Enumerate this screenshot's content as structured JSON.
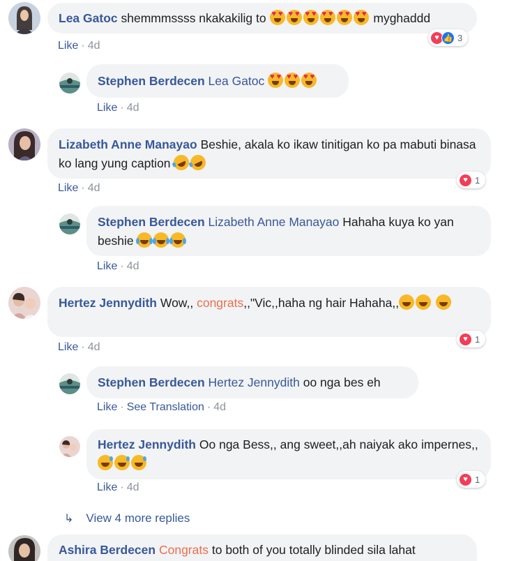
{
  "comments": [
    {
      "author": "Lea Gatoc",
      "text": "shemmmssss nkakakilig to",
      "text_after": "myghaddd",
      "emoji_count": 6,
      "like": "Like",
      "time": "4d",
      "reactions": {
        "count": "3",
        "icons": [
          "love-icon",
          "like-icon"
        ]
      }
    },
    {
      "author": "Stephen Berdecen",
      "mention": "Lea Gatoc",
      "like": "Like",
      "time": "4d"
    },
    {
      "author": "Lizabeth Anne Manayao",
      "text": "Beshie, akala ko ikaw tinitigan ko pa mabuti binasa ko lang yung caption",
      "like": "Like",
      "time": "4d",
      "reactions": {
        "count": "1",
        "icons": [
          "love-icon"
        ]
      }
    },
    {
      "author": "Stephen Berdecen",
      "mention": "Lizabeth Anne Manayao",
      "text": "Hahaha kuya ko yan beshie",
      "like": "Like",
      "time": "4d"
    },
    {
      "author": "Hertez Jennydith",
      "text_pre": "Wow,,",
      "highlight": "congrats",
      "text_post": ",,\"Vic,,haha ng hair Hahaha,,",
      "like": "Like",
      "time": "4d",
      "reactions": {
        "count": "1",
        "icons": [
          "love-icon"
        ]
      }
    },
    {
      "author": "Stephen Berdecen",
      "mention": "Hertez Jennydith",
      "text": "oo nga bes eh",
      "like": "Like",
      "translate": "See Translation",
      "time": "4d"
    },
    {
      "author": "Hertez Jennydith",
      "text": "Oo nga Bess,, ang sweet,,ah naiyak ako impernes,,",
      "like": "Like",
      "time": "4d",
      "reactions": {
        "count": "1",
        "icons": [
          "love-icon"
        ]
      }
    },
    {
      "author": "Ashira Berdecen",
      "highlight": "Congrats",
      "text": "to both of you totally blinded sila lahat"
    }
  ],
  "view_more": "View 4 more replies",
  "colors": {
    "link": "#385898",
    "bubble": "#f2f3f5",
    "highlight": "#e9704e",
    "love": "#f33e58",
    "like": "#1877f2"
  }
}
